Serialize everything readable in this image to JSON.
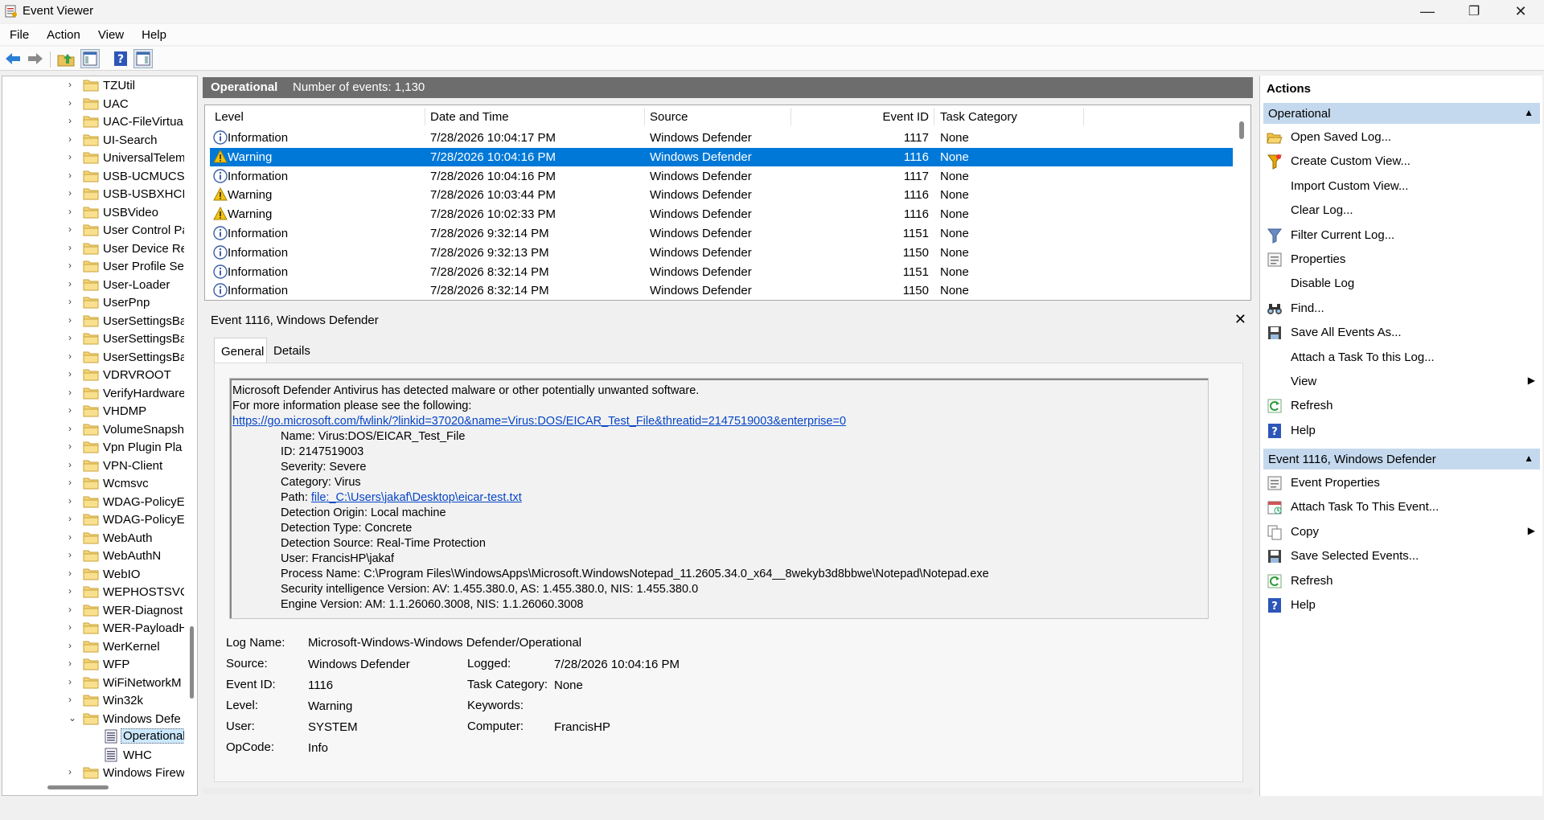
{
  "window": {
    "title": "Event Viewer",
    "minimize": "—",
    "restore": "❐",
    "close": "✕"
  },
  "menu": [
    "File",
    "Action",
    "View",
    "Help"
  ],
  "tree": {
    "items": [
      "TZUtil",
      "UAC",
      "UAC-FileVirtua",
      "UI-Search",
      "UniversalTelem",
      "USB-UCMUCSI",
      "USB-USBXHCI",
      "USBVideo",
      "User Control Pa",
      "User Device Re",
      "User Profile Ser",
      "User-Loader",
      "UserPnp",
      "UserSettingsBa",
      "UserSettingsBa",
      "UserSettingsBa",
      "VDRVROOT",
      "VerifyHardware",
      "VHDMP",
      "VolumeSnapsh",
      "Vpn Plugin Pla",
      "VPN-Client",
      "Wcmsvc",
      "WDAG-PolicyE",
      "WDAG-PolicyE",
      "WebAuth",
      "WebAuthN",
      "WebIO",
      "WEPHOSTSVC",
      "WER-Diagnost",
      "WER-PayloadH",
      "WerKernel",
      "WFP",
      "WiFiNetworkM",
      "Win32k",
      "Windows Defe"
    ],
    "children": [
      "Operational",
      "WHC"
    ],
    "last": "Windows Firew"
  },
  "log": {
    "name": "Operational",
    "count": "Number of events: 1,130"
  },
  "columns": {
    "level": "Level",
    "datetime": "Date and Time",
    "source": "Source",
    "eventid": "Event ID",
    "task": "Task Category"
  },
  "events": [
    {
      "level": "Information",
      "icon": "info-icon",
      "datetime": "7/28/2026 10:04:17 PM",
      "source": "Windows Defender",
      "id": "1117",
      "task": "None"
    },
    {
      "level": "Warning",
      "icon": "warning-icon",
      "datetime": "7/28/2026 10:04:16 PM",
      "source": "Windows Defender",
      "id": "1116",
      "task": "None",
      "selected": true
    },
    {
      "level": "Information",
      "icon": "info-icon",
      "datetime": "7/28/2026 10:04:16 PM",
      "source": "Windows Defender",
      "id": "1117",
      "task": "None"
    },
    {
      "level": "Warning",
      "icon": "warning-icon",
      "datetime": "7/28/2026 10:03:44 PM",
      "source": "Windows Defender",
      "id": "1116",
      "task": "None"
    },
    {
      "level": "Warning",
      "icon": "warning-icon",
      "datetime": "7/28/2026 10:02:33 PM",
      "source": "Windows Defender",
      "id": "1116",
      "task": "None"
    },
    {
      "level": "Information",
      "icon": "info-icon",
      "datetime": "7/28/2026 9:32:14 PM",
      "source": "Windows Defender",
      "id": "1151",
      "task": "None"
    },
    {
      "level": "Information",
      "icon": "info-icon",
      "datetime": "7/28/2026 9:32:13 PM",
      "source": "Windows Defender",
      "id": "1150",
      "task": "None"
    },
    {
      "level": "Information",
      "icon": "info-icon",
      "datetime": "7/28/2026 8:32:14 PM",
      "source": "Windows Defender",
      "id": "1151",
      "task": "None"
    },
    {
      "level": "Information",
      "icon": "info-icon",
      "datetime": "7/28/2026 8:32:14 PM",
      "source": "Windows Defender",
      "id": "1150",
      "task": "None"
    }
  ],
  "detail": {
    "title": "Event 1116, Windows Defender",
    "tabs": [
      "General",
      "Details"
    ],
    "description": {
      "line1": "Microsoft Defender Antivirus has detected malware or other potentially unwanted software.",
      "line2": " For more information please see the following:",
      "link": "https://go.microsoft.com/fwlink/?linkid=37020&name=Virus:DOS/EICAR_Test_File&threatid=2147519003&enterprise=0",
      "name": "Name: Virus:DOS/EICAR_Test_File",
      "id": "ID: 2147519003",
      "severity": "Severity: Severe",
      "category": "Category: Virus",
      "path_label": "Path: ",
      "path_link": "file:_C:\\Users\\jakaf\\Desktop\\eicar-test.txt",
      "origin": "Detection Origin: Local machine",
      "type": "Detection Type: Concrete",
      "source": "Detection Source: Real-Time Protection",
      "user": "User: FrancisHP\\jakaf",
      "process": "Process Name: C:\\Program Files\\WindowsApps\\Microsoft.WindowsNotepad_11.2605.34.0_x64__8wekyb3d8bbwe\\Notepad\\Notepad.exe",
      "intel": "Security intelligence Version: AV: 1.455.380.0, AS: 1.455.380.0, NIS: 1.455.380.0",
      "engine": "Engine Version: AM: 1.1.26060.3008, NIS: 1.1.26060.3008"
    },
    "fields": {
      "log_name_k": "Log Name:",
      "log_name_v": "Microsoft-Windows-Windows Defender/Operational",
      "source_k": "Source:",
      "source_v": "Windows Defender",
      "logged_k": "Logged:",
      "logged_v": "7/28/2026 10:04:16 PM",
      "eventid_k": "Event ID:",
      "eventid_v": "1116",
      "taskcat_k": "Task Category:",
      "taskcat_v": "None",
      "level_k": "Level:",
      "level_v": "Warning",
      "keywords_k": "Keywords:",
      "keywords_v": "",
      "user_k": "User:",
      "user_v": "SYSTEM",
      "computer_k": "Computer:",
      "computer_v": "FrancisHP",
      "opcode_k": "OpCode:",
      "opcode_v": "Info"
    }
  },
  "actions": {
    "title": "Actions",
    "section1": "Operational",
    "items1": [
      {
        "label": "Open Saved Log...",
        "icon": "open-folder-icon"
      },
      {
        "label": "Create Custom View...",
        "icon": "funnel-icon"
      },
      {
        "label": "Import Custom View...",
        "icon": ""
      },
      {
        "label": "Clear Log...",
        "icon": ""
      },
      {
        "label": "Filter Current Log...",
        "icon": "filter-icon"
      },
      {
        "label": "Properties",
        "icon": "properties-icon"
      },
      {
        "label": "Disable Log",
        "icon": ""
      },
      {
        "label": "Find...",
        "icon": "binoculars-icon"
      },
      {
        "label": "Save All Events As...",
        "icon": "save-icon"
      },
      {
        "label": "Attach a Task To this Log...",
        "icon": ""
      },
      {
        "label": "View",
        "icon": "",
        "submenu": true
      },
      {
        "label": "Refresh",
        "icon": "refresh-icon"
      },
      {
        "label": "Help",
        "icon": "help-icon"
      }
    ],
    "section2": "Event 1116, Windows Defender",
    "items2": [
      {
        "label": "Event Properties",
        "icon": "properties-icon"
      },
      {
        "label": "Attach Task To This Event...",
        "icon": "task-icon"
      },
      {
        "label": "Copy",
        "icon": "copy-icon",
        "submenu": true
      },
      {
        "label": "Save Selected Events...",
        "icon": "save-icon"
      },
      {
        "label": "Refresh",
        "icon": "refresh-icon"
      },
      {
        "label": "Help",
        "icon": "help-icon"
      }
    ]
  },
  "colors": {
    "selection": "#0078d7",
    "section_header": "#c5d9ee",
    "log_header": "#6d6d6d",
    "link": "#0645c8"
  }
}
